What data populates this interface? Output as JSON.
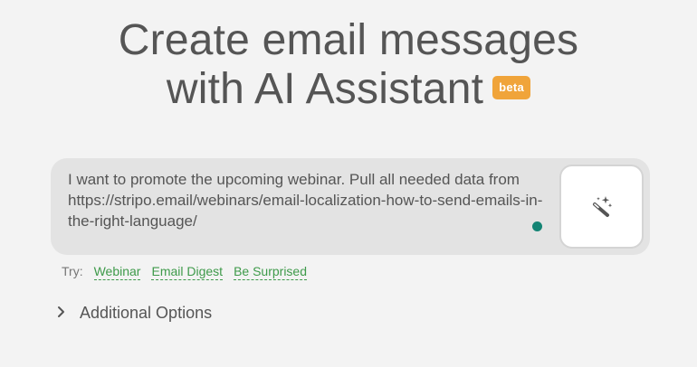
{
  "hero": {
    "title_line1": "Create email messages",
    "title_line2": "with AI Assistant",
    "badge": "beta"
  },
  "prompt": {
    "value": "I want to promote the upcoming webinar. Pull all needed data from https://stripo.email/webinars/email-localization-how-to-send-emails-in-the-right-language/",
    "generate_icon": "magic-wand-icon"
  },
  "suggestions": {
    "label": "Try:",
    "items": [
      "Webinar",
      "Email Digest",
      "Be Surprised"
    ]
  },
  "options": {
    "label": "Additional Options",
    "icon": "chevron-right-icon"
  },
  "colors": {
    "background": "#f3f3f3",
    "badge": "#f0a43a",
    "link": "#3e9a4a",
    "status_dot": "#148474",
    "prompt_bg": "#e3e3e3"
  }
}
